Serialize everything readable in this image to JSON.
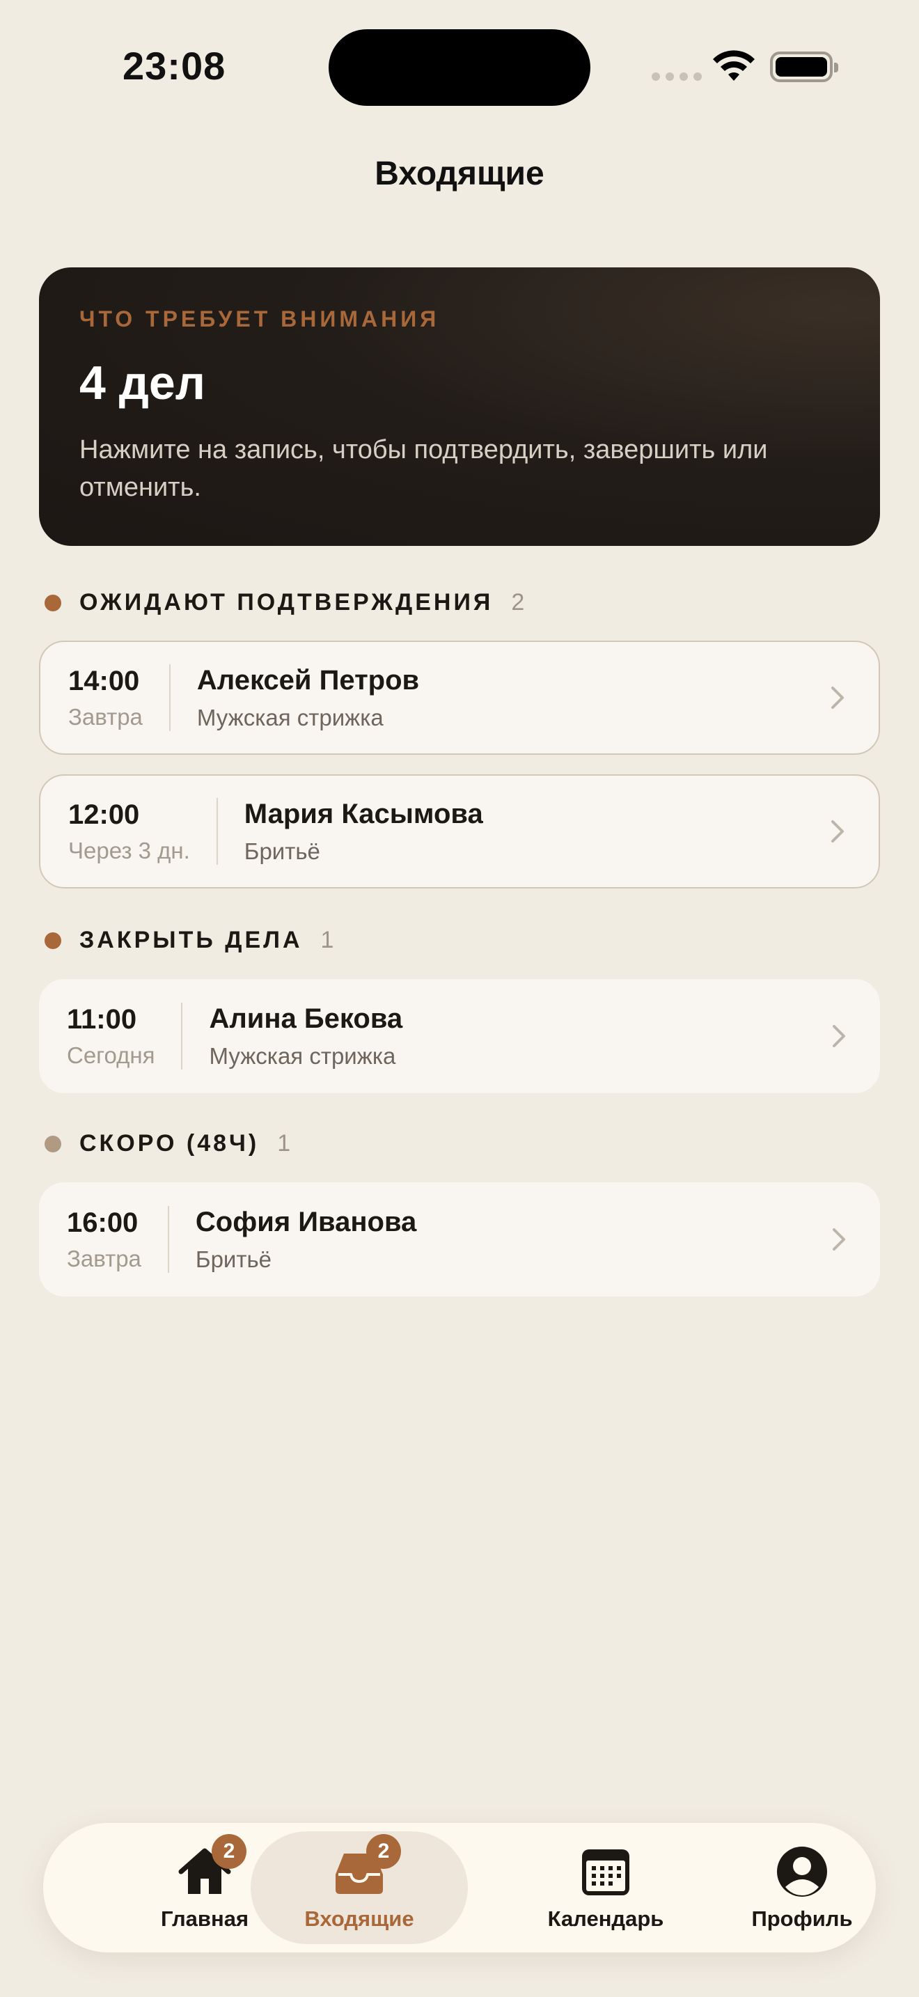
{
  "status_bar": {
    "time": "23:08"
  },
  "header": {
    "title": "Входящие"
  },
  "hero": {
    "eyebrow": "ЧТО ТРЕБУЕТ ВНИМАНИЯ",
    "count": "4 дел",
    "description": "Нажмите на запись, чтобы подтвердить, завершить или отменить."
  },
  "sections": [
    {
      "title": "ОЖИДАЮТ ПОДТВЕРЖДЕНИЯ",
      "count": "2",
      "dot_color": "#A9683A",
      "items": [
        {
          "time": "14:00",
          "when": "Завтра",
          "name": "Алексей Петров",
          "service": "Мужская стрижка"
        },
        {
          "time": "12:00",
          "when": "Через 3 дн.",
          "name": "Мария Касымова",
          "service": "Бритьё"
        }
      ]
    },
    {
      "title": "ЗАКРЫТЬ ДЕЛА",
      "count": "1",
      "dot_color": "#A9683A",
      "items": [
        {
          "time": "11:00",
          "when": "Сегодня",
          "name": "Алина Бекова",
          "service": "Мужская стрижка"
        }
      ]
    },
    {
      "title": "СКОРО (48Ч)",
      "count": "1",
      "dot_color": "#B09A82",
      "items": [
        {
          "time": "16:00",
          "when": "Завтра",
          "name": "София Иванова",
          "service": "Бритьё"
        }
      ]
    }
  ],
  "tabbar": {
    "tabs": [
      {
        "label": "Главная",
        "icon": "home-icon",
        "badge": "2"
      },
      {
        "label": "Входящие",
        "icon": "inbox-icon",
        "badge": "2",
        "active": true
      },
      {
        "label": "Календарь",
        "icon": "calendar-icon"
      },
      {
        "label": "Профиль",
        "icon": "profile-icon"
      }
    ]
  },
  "colors": {
    "background": "#F1ECE2",
    "accent": "#A9683A",
    "hero_bg": "#1C1714",
    "card_bg": "#F9F6F1"
  }
}
